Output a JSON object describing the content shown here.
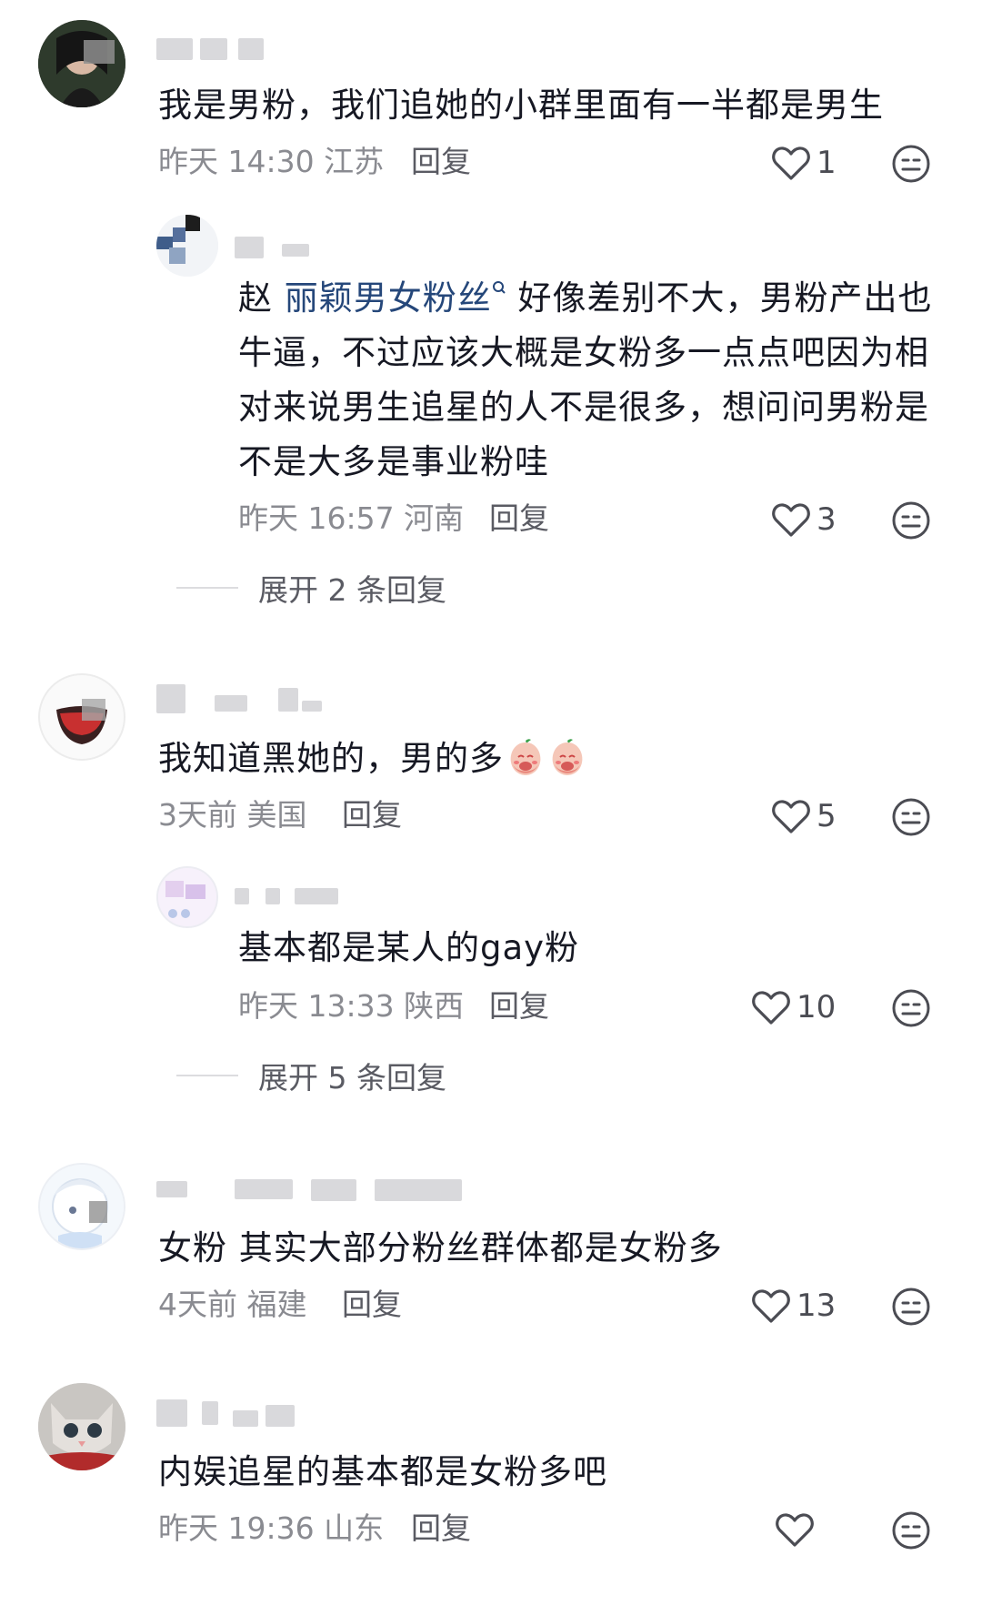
{
  "comments": [
    {
      "text": "我是男粉，我们追她的小群里面有一半都是男生",
      "time": "昨天 14:30",
      "location": "江苏",
      "reply_label": "回复",
      "likes": "1",
      "replies": [
        {
          "mention": "赵 丽颖男女粉丝",
          "text": "好像差别不大，男粉产出也牛逼，不过应该大概是女粉多一点点吧因为相对来说男生追星的人不是很多，想问问男粉是不是大多是事业粉哇",
          "line1_rest": " 好像差别不大，男粉产出也",
          "line2": "牛逼，不过应该大概是女粉多一点点吧因为相",
          "line3": "对来说男生追星的人不是很多，想问问男粉是",
          "line4": "不是大多是事业粉哇",
          "time": "昨天 16:57",
          "location": "河南",
          "reply_label": "回复",
          "likes": "3"
        }
      ],
      "expand_label": "展开 2 条回复"
    },
    {
      "text": "我知道黑她的，男的多",
      "time": "3天前",
      "location": "美国",
      "reply_label": "回复",
      "likes": "5",
      "replies": [
        {
          "text": "基本都是某人的gay粉",
          "time": "昨天 13:33",
          "location": "陕西",
          "reply_label": "回复",
          "likes": "10"
        }
      ],
      "expand_label": "展开 5 条回复"
    },
    {
      "text": "女粉 其实大部分粉丝群体都是女粉多",
      "time": "4天前",
      "location": "福建",
      "reply_label": "回复",
      "likes": "13"
    },
    {
      "text": "内娱追星的基本都是女粉多吧",
      "time": "昨天 19:36",
      "location": "山东",
      "reply_label": "回复",
      "likes": ""
    }
  ],
  "icons": {
    "like": "heart-outline-icon",
    "dislike": "neutral-face-icon",
    "emoji": "peach-face-emoji"
  },
  "colors": {
    "text": "#161823",
    "meta": "#8a8b91",
    "mention": "#25477a"
  }
}
